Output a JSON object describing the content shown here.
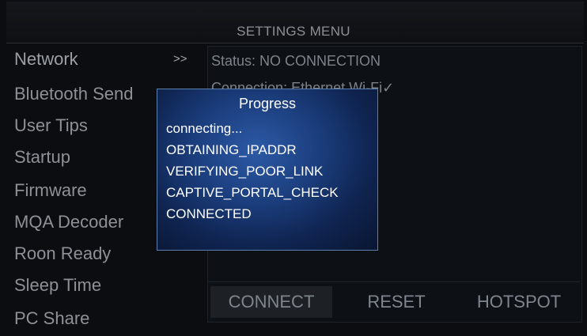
{
  "header": {
    "title": "SETTINGS MENU"
  },
  "sidebar": {
    "chevron": ">>",
    "items": [
      {
        "label": "Network"
      },
      {
        "label": "Bluetooth Send"
      },
      {
        "label": "User Tips"
      },
      {
        "label": "Startup"
      },
      {
        "label": "Firmware"
      },
      {
        "label": "MQA Decoder"
      },
      {
        "label": "Roon Ready"
      },
      {
        "label": "Sleep Time"
      },
      {
        "label": "PC Share"
      }
    ]
  },
  "network_panel": {
    "status": "Status: NO CONNECTION",
    "connection": "Connection: Ethernet    Wi-Fi✓"
  },
  "buttons": {
    "connect": "CONNECT",
    "reset": "RESET",
    "hotspot": "HOTSPOT"
  },
  "progress_dialog": {
    "title": "Progress",
    "lines": [
      "connecting...",
      "OBTAINING_IPADDR",
      "VERIFYING_POOR_LINK",
      "CAPTIVE_PORTAL_CHECK",
      "CONNECTED"
    ]
  },
  "colors": {
    "dialog_blue": "#1b3d7c",
    "dialog_border": "#5d7fb0",
    "text_muted": "#8d9197"
  }
}
